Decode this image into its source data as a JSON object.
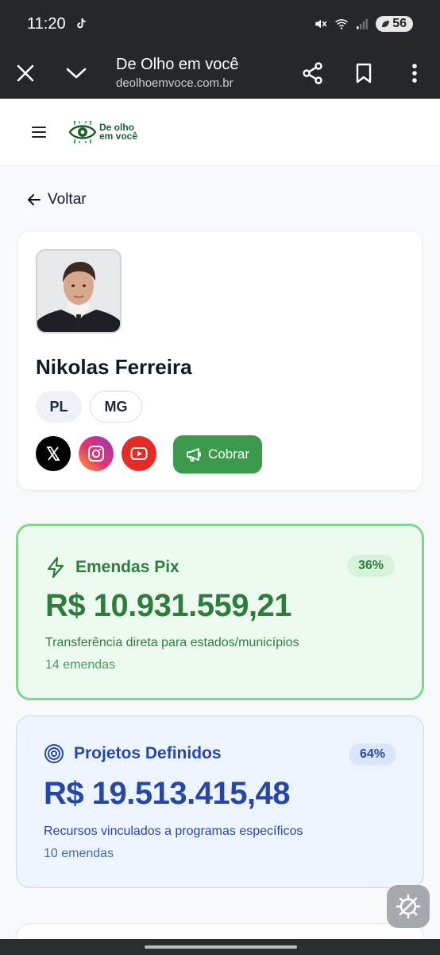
{
  "status_bar": {
    "time": "11:20",
    "battery": "56"
  },
  "toolbar": {
    "title": "De Olho em você",
    "url": "deolhoemvoce.com.br"
  },
  "site": {
    "logo_line1": "De olho",
    "logo_line2": "em você"
  },
  "back_label": "Voltar",
  "profile": {
    "name": "Nikolas Ferreira",
    "party": "PL",
    "state": "MG",
    "cobrar_label": "Cobrar"
  },
  "cards": {
    "pix": {
      "title": "Emendas Pix",
      "percent": "36%",
      "amount": "R$ 10.931.559,21",
      "description": "Transferência direta para estados/municípios",
      "count": "14 emendas"
    },
    "projects": {
      "title": "Projetos Definidos",
      "percent": "64%",
      "amount": "R$ 19.513.415,48",
      "description": "Recursos vinculados a programas específicos",
      "count": "10 emendas"
    }
  },
  "colors": {
    "pix_accent": "#2f7d3d",
    "projects_accent": "#2547a8",
    "cobrar_button": "#3c9a4c"
  },
  "icons": [
    "tiktok-icon",
    "mute-icon",
    "wifi-icon",
    "signal-icon",
    "close-icon",
    "chevron-down-icon",
    "share-icon",
    "bookmark-icon",
    "more-vert-icon",
    "menu-icon",
    "eye-logo-icon",
    "arrow-left-icon",
    "x-icon",
    "instagram-icon",
    "youtube-icon",
    "megaphone-icon",
    "lightning-icon",
    "target-icon",
    "settings-tools-icon"
  ]
}
